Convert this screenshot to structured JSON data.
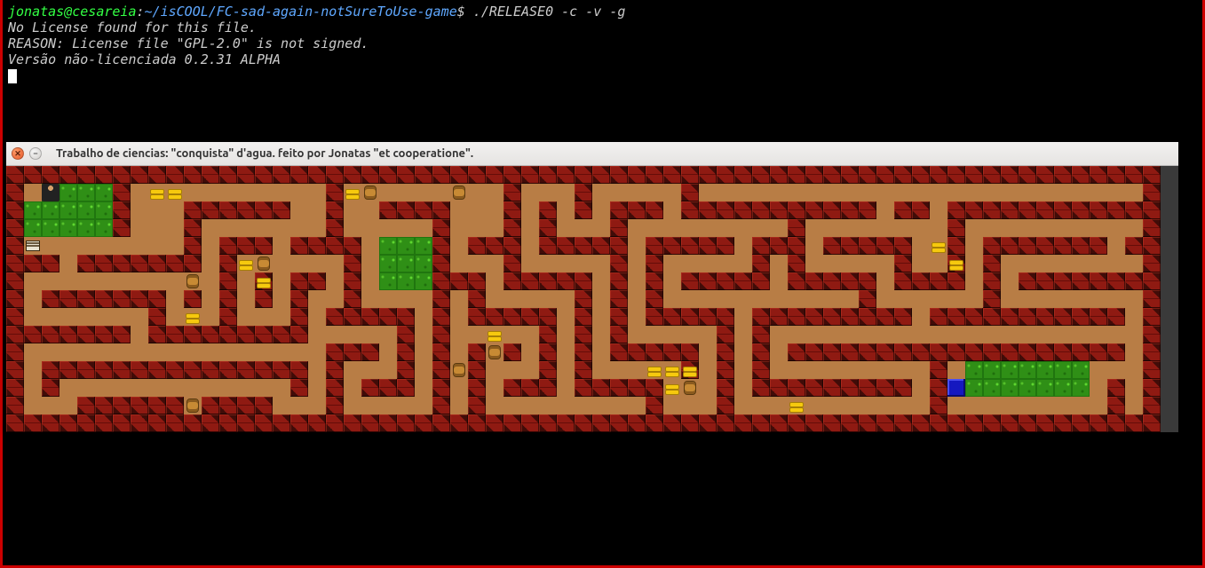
{
  "terminal": {
    "user": "jonatas@cesareia",
    "path": "~/isCOOL/FC-sad-again-notSureToUse-game",
    "prompt_symbol": "$",
    "command": "./RELEASE0 -c -v -g",
    "lines": [
      "No License found for this file.",
      "REASON: License file \"GPL-2.0\" is not signed.",
      "Versão não-licenciada 0.2.31 ALPHA"
    ]
  },
  "window": {
    "title": "Trabalho de ciencias: \"conquista\" d'agua. feito por Jonatas \"et cooperatione\".",
    "close_glyph": "✕",
    "minimize_glyph": "–"
  },
  "game": {
    "tile_size": 20,
    "cols": 65,
    "rows": 15,
    "legend": {
      "W": "wall",
      "G": "grass",
      ".": "path"
    },
    "map": [
      "WWWWWWWWWWWWWWWWWWWWWWWWWWWWWWWWWWWWWWWWWWWWWWWWWWWWWWWWWWWWWWWWW",
      "W.GGGGW...........W.........W...W.....W.........................W",
      "WGGGGGW...WWWWWW..W..WWWW...W.W.W.WWW.WWWWWWWWWWW.WW.WWWWWWWWWWWW",
      "WGGGGGW...W.......W.....W...W.W...W.........W........W..........W",
      "W.........W.WWW.WWWW.GGGW.WWW.WWWWW.WWWWW.WWW.WWWWW..W.WWWWWWW.WW",
      "WWW.WWWWWWW.W.W....W.GGGW...W.....W.W.....W.W.....W..W.W........W",
      "W.........W.W.W.WW.W.GGGWWW.WWWWW.W.W.WWWWW.WWWWW.WWWW.W.WWWWWWWW",
      "W.WWWWWWW.W.W.W.W..W....W.W.....W.W.W...........W......W........W",
      "W.......W...W...W.WWWWW.W.WWWWW.W.W.WWWWW.WWWWWWWWW.WWWWWWWWWWW.W",
      "WWWWWWW.WWWWWWWWW.....W.W.....W.W.W.....W.W.....................W",
      "W.................WWW.W.W.WWW.W.W.WWWWW.W.W.WWWWWWWWWWWWWWWWWWW.W",
      "W.WWWWWWWWWWWWWWW.W...W.W.W...W.W.....W.W.W.........W.GGGGGGG...W",
      "W.W.............W.W.WWW.W.W.WWW.WWWWW.W.W.WWWWWWWWW.W.GGGGGGG.W.W",
      "W...WWWWWWWWWWW...W.....W.W.........W...W...........W.........W.W",
      "WWWWWWWWWWWWWWWWWWWWWWWWWWWWWWWWWWWWWWWWWWWWWWWWWWWWWWWWWWWWWWWWW"
    ],
    "sprites": {
      "player": [
        [
          2,
          1
        ]
      ],
      "sign": [
        [
          1,
          4
        ]
      ],
      "water": [
        [
          53,
          12
        ]
      ],
      "barrel": [
        [
          10,
          6
        ],
        [
          14,
          5
        ],
        [
          20,
          1
        ],
        [
          25,
          1
        ],
        [
          25,
          11
        ],
        [
          27,
          10
        ],
        [
          38,
          12
        ],
        [
          10,
          13
        ]
      ],
      "gold": [
        [
          8,
          1
        ],
        [
          9,
          1
        ],
        [
          19,
          1
        ],
        [
          10,
          8
        ],
        [
          13,
          5
        ],
        [
          14,
          6
        ],
        [
          27,
          9
        ],
        [
          36,
          11
        ],
        [
          37,
          11
        ],
        [
          37,
          12
        ],
        [
          38,
          11
        ],
        [
          44,
          13
        ],
        [
          52,
          4
        ],
        [
          53,
          5
        ]
      ]
    }
  }
}
